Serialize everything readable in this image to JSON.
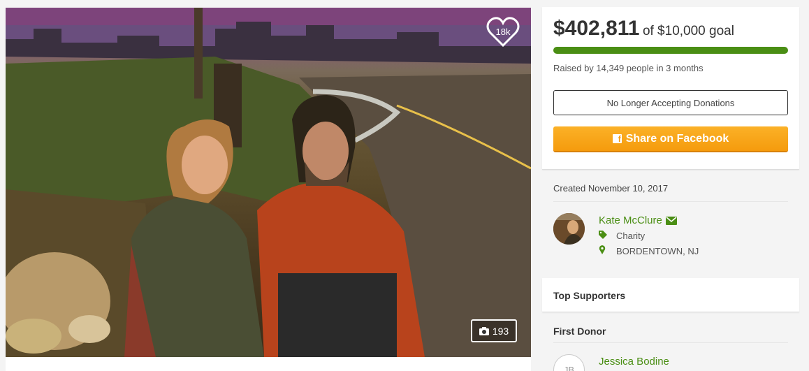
{
  "campaign": {
    "heart_count": "18k",
    "photo_count": "193",
    "amount_raised": "$402,811",
    "goal_text": "of $10,000 goal",
    "progress_fraction": 1.0,
    "raised_text": "Raised by 14,349 people in 3 months",
    "no_longer_label": "No Longer Accepting Donations",
    "share_label": "Share on Facebook"
  },
  "info": {
    "created": "Created November 10, 2017",
    "organizer_name": "Kate McClure",
    "category": "Charity",
    "location": "BORDENTOWN, NJ"
  },
  "supporters": {
    "title": "Top Supporters",
    "first_donor_title": "First Donor",
    "first_donor_initials": "JB",
    "first_donor_name": "Jessica Bodine"
  },
  "colors": {
    "accent_green": "#4a8e14",
    "share_orange": "#f59b0d"
  },
  "icons": {
    "heart": "heart-icon",
    "camera": "camera-icon",
    "facebook": "facebook-icon",
    "mail": "mail-icon",
    "tag": "tag-icon",
    "location": "map-marker-icon"
  }
}
